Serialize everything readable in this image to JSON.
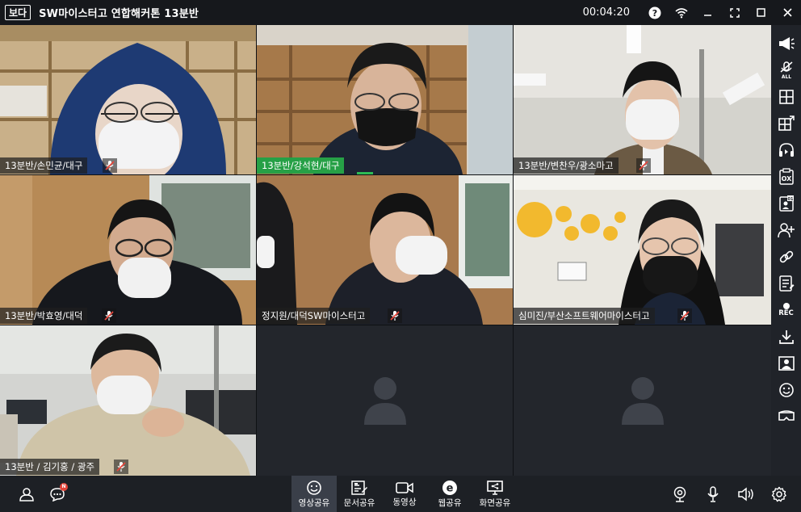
{
  "app": {
    "logo_text": "보다",
    "title": "SW마이스터고 연합해커톤 13분반",
    "timer": "00:04:20"
  },
  "tiles": [
    {
      "name": "13분반/손민균/대구",
      "active": false,
      "muted": true
    },
    {
      "name": "13분반/강석현/대구",
      "active": true,
      "muted": false
    },
    {
      "name": "13분반/변찬우/광소마고",
      "active": false,
      "muted": true
    },
    {
      "name": "13분반/박효영/대덕",
      "active": false,
      "muted": true
    },
    {
      "name": "정지원/대덕SW마이스터고",
      "active": false,
      "muted": true
    },
    {
      "name": "심미진/부산소프트웨어마이스터고",
      "active": false,
      "muted": true
    },
    {
      "name": "13분반 / 김기홍 / 광주",
      "active": false,
      "muted": true
    },
    {
      "name": "",
      "empty": true
    },
    {
      "name": "",
      "empty": true
    }
  ],
  "sidebar": {
    "items": [
      "megaphone-icon",
      "all-mic-icon",
      "layout-grid-icon",
      "layout-focus-icon",
      "headset-icon",
      "ox-quiz-icon",
      "attendance-icon",
      "add-user-icon",
      "link-icon",
      "notes-icon",
      "record-icon",
      "download-icon",
      "profile-card-icon",
      "emoji-icon",
      "vr-icon"
    ],
    "rec_label": "REC"
  },
  "bottombar": {
    "tools": [
      {
        "label": "영상공유",
        "icon": "smile-icon",
        "active": true
      },
      {
        "label": "문서공유",
        "icon": "document-share-icon",
        "active": false
      },
      {
        "label": "동영상",
        "icon": "video-icon",
        "active": false
      },
      {
        "label": "웹공유",
        "icon": "web-e-icon",
        "active": false
      },
      {
        "label": "화면공유",
        "icon": "screen-share-icon",
        "active": false
      }
    ],
    "chat_badge": "N"
  },
  "colors": {
    "active_speaker": "#26a046",
    "mute_icon": "#e8473c",
    "toolbar_bg": "#1d2025",
    "sidebar_bg": "#202329"
  }
}
